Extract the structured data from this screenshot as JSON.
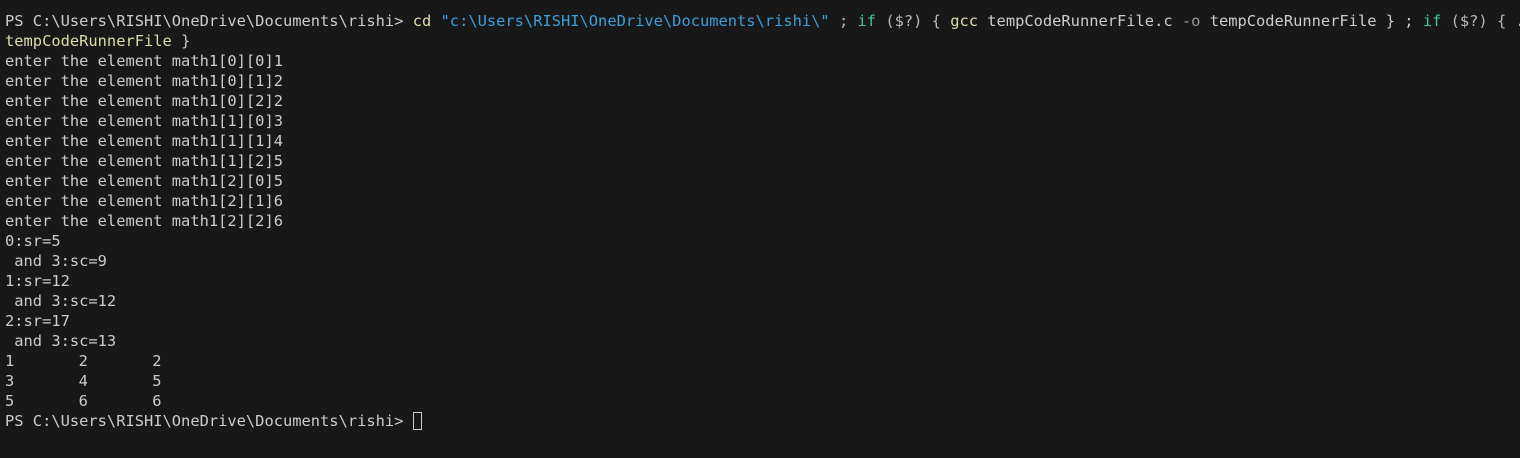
{
  "terminal": {
    "prompt": "PS C:\\Users\\RISHI\\OneDrive\\Documents\\rishi> ",
    "command": {
      "cd": "cd",
      "path": "\"c:\\Users\\RISHI\\OneDrive\\Documents\\rishi\\\"",
      "sep1": " ; ",
      "if1": "if",
      "cond1": " ($?) { ",
      "gcc": "gcc",
      "gcc_args": " tempCodeRunnerFile.c ",
      "o_flag": "-o",
      "gcc_out": " tempCodeRunnerFile } ; ",
      "if2": "if",
      "cond2": " ($?) { ",
      "run_prefix": ".\\",
      "run_name": "tempCodeRunnerFile",
      "close": " }"
    },
    "output_lines": [
      "enter the element math1[0][0]1",
      "enter the element math1[0][1]2",
      "enter the element math1[0][2]2",
      "enter the element math1[1][0]3",
      "enter the element math1[1][1]4",
      "enter the element math1[1][2]5",
      "enter the element math1[2][0]5",
      "enter the element math1[2][1]6",
      "enter the element math1[2][2]6",
      "0:sr=5",
      " and 3:sc=9",
      "1:sr=12",
      " and 3:sc=12",
      "2:sr=17",
      " and 3:sc=13"
    ],
    "matrix": [
      [
        "1",
        "2",
        "2"
      ],
      [
        "3",
        "4",
        "5"
      ],
      [
        "5",
        "6",
        "6"
      ]
    ],
    "final_prompt": "PS C:\\Users\\RISHI\\OneDrive\\Documents\\rishi> "
  },
  "colors": {
    "background": "#181818",
    "text": "#cccccc",
    "command": "#dcdcaa",
    "string": "#3b9fd9",
    "keyword": "#3fc49b"
  }
}
